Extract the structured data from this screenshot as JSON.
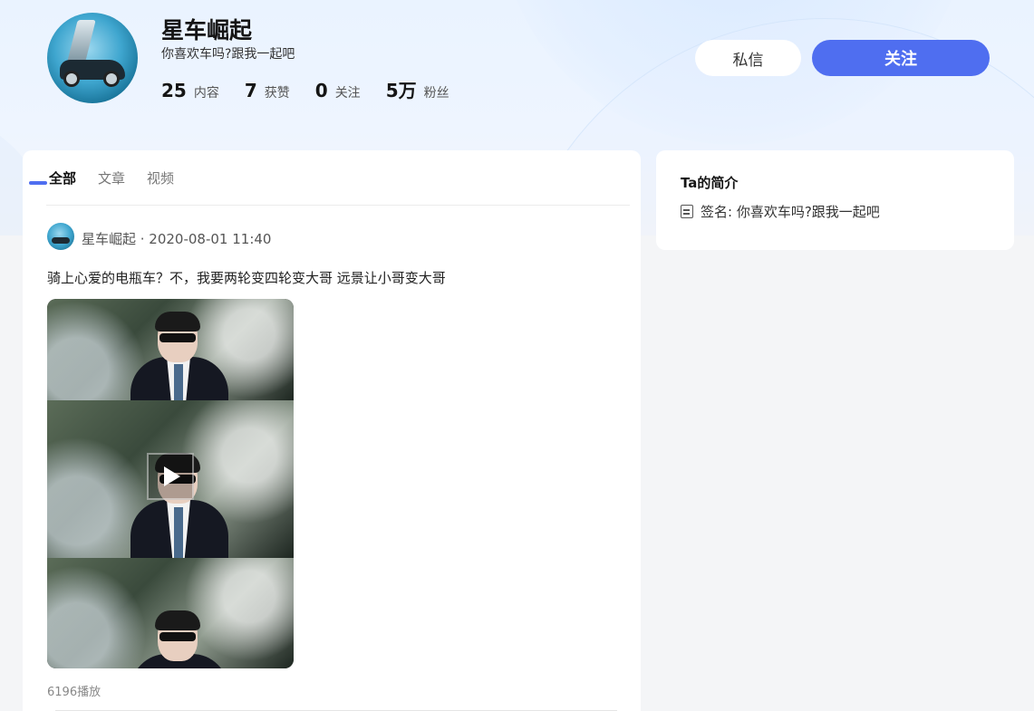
{
  "profile": {
    "username": "星车崛起",
    "bio": "你喜欢车吗?跟我一起吧",
    "stats": [
      {
        "num": "25",
        "label": "内容"
      },
      {
        "num": "7",
        "label": "获赞"
      },
      {
        "num": "0",
        "label": "关注"
      },
      {
        "num": "5万",
        "label": "粉丝"
      }
    ]
  },
  "actions": {
    "message_label": "私信",
    "follow_label": "关注"
  },
  "tabs": [
    {
      "label": "全部",
      "active": true
    },
    {
      "label": "文章",
      "active": false
    },
    {
      "label": "视频",
      "active": false
    }
  ],
  "post": {
    "meta": "星车崛起 · 2020-08-01 11:40",
    "text": "骑上心爱的电瓶车？不，我要两轮变四轮变大哥 远景让小哥变大哥",
    "plays": "6196播放"
  },
  "sidebar": {
    "title": "Ta的简介",
    "signature": "签名: 你喜欢车吗?跟我一起吧"
  },
  "colors": {
    "accent": "#4f6ef0",
    "page_bg": "#f4f5f7",
    "header_bg": "#eaf3ff"
  }
}
